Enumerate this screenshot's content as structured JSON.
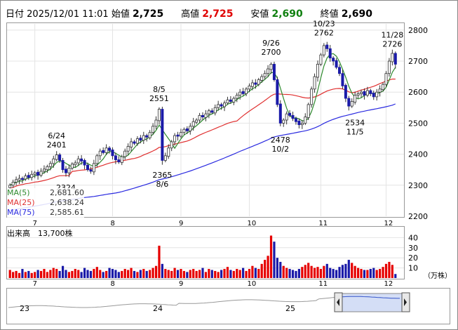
{
  "header": {
    "date_label": "日付",
    "datetime": "2025/12/01 11:01",
    "open_label": "始値",
    "open": "2,725",
    "high_label": "高値",
    "high": "2,725",
    "low_label": "安値",
    "low": "2,690",
    "close_label": "終値",
    "close": "2,690"
  },
  "colors": {
    "up": "#e60000",
    "down": "#1a1aa8",
    "ma5": "#2e8b2e",
    "ma25": "#e03030",
    "ma75": "#2a2ae0",
    "high": "#e00000",
    "low": "#108010"
  },
  "ma_legend": [
    {
      "label": "MA(5)",
      "value": "2,681.60"
    },
    {
      "label": "MA(25)",
      "value": "2,638.24"
    },
    {
      "label": "MA(75)",
      "value": "2,585.61"
    }
  ],
  "volume_label": "出来高　13,700株",
  "volume_unit": "（万株）",
  "chart_data": {
    "type": "candlestick",
    "price_axis": {
      "ylim": [
        2200,
        2820
      ],
      "ticks": [
        2200,
        2300,
        2400,
        2500,
        2600,
        2700,
        2800
      ]
    },
    "x_axis": {
      "month_ticks": [
        "7",
        "8",
        "9",
        "10",
        "11",
        "12"
      ]
    },
    "annotations": [
      {
        "date": "6/24",
        "value": 2401,
        "position": "above"
      },
      {
        "date": "",
        "value": 2324,
        "position": "below"
      },
      {
        "date": "8/5",
        "value": 2551,
        "position": "above"
      },
      {
        "date": "8/6",
        "value": 2365,
        "position": "below"
      },
      {
        "date": "9/26",
        "value": 2700,
        "position": "above"
      },
      {
        "date": "10/2",
        "value": 2478,
        "position": "below"
      },
      {
        "date": "10/23",
        "value": 2762,
        "position": "above"
      },
      {
        "date": "11/5",
        "value": 2534,
        "position": "below"
      },
      {
        "date": "11/28",
        "value": 2726,
        "position": "above"
      }
    ],
    "closes": [
      2300,
      2310,
      2318,
      2322,
      2320,
      2330,
      2325,
      2335,
      2340,
      2332,
      2345,
      2352,
      2360,
      2370,
      2385,
      2398,
      2380,
      2350,
      2340,
      2355,
      2368,
      2372,
      2385,
      2378,
      2365,
      2350,
      2345,
      2370,
      2395,
      2410,
      2405,
      2420,
      2412,
      2395,
      2382,
      2375,
      2392,
      2410,
      2425,
      2440,
      2435,
      2450,
      2445,
      2460,
      2455,
      2470,
      2490,
      2510,
      2545,
      2380,
      2395,
      2420,
      2440,
      2460,
      2458,
      2470,
      2480,
      2475,
      2490,
      2505,
      2510,
      2525,
      2520,
      2530,
      2540,
      2535,
      2550,
      2560,
      2555,
      2565,
      2575,
      2570,
      2580,
      2590,
      2600,
      2595,
      2610,
      2620,
      2630,
      2625,
      2640,
      2650,
      2660,
      2675,
      2690,
      2640,
      2560,
      2500,
      2510,
      2530,
      2525,
      2515,
      2505,
      2495,
      2500,
      2520,
      2560,
      2610,
      2650,
      2690,
      2720,
      2750,
      2740,
      2710,
      2700,
      2680,
      2660,
      2620,
      2580,
      2555,
      2570,
      2590,
      2595,
      2600,
      2590,
      2605,
      2595,
      2585,
      2600,
      2610,
      2625,
      2660,
      2700,
      2725,
      2690
    ],
    "ma_series": [
      {
        "name": "MA(5)",
        "last": 2681.6
      },
      {
        "name": "MA(25)",
        "last": 2638.24
      },
      {
        "name": "MA(75)",
        "last": 2585.61
      }
    ],
    "volume": {
      "ylim": [
        0,
        50
      ],
      "ticks": [
        10,
        20,
        30,
        40
      ],
      "values": [
        8,
        6,
        7,
        5,
        9,
        6,
        7,
        5,
        6,
        8,
        7,
        9,
        6,
        8,
        10,
        9,
        7,
        12,
        8,
        6,
        7,
        9,
        8,
        6,
        10,
        8,
        7,
        9,
        11,
        8,
        6,
        7,
        10,
        9,
        8,
        6,
        7,
        9,
        8,
        10,
        7,
        6,
        8,
        9,
        7,
        8,
        10,
        12,
        32,
        14,
        9,
        8,
        7,
        10,
        8,
        9,
        7,
        6,
        8,
        9,
        7,
        8,
        10,
        6,
        9,
        8,
        7,
        6,
        8,
        9,
        11,
        8,
        7,
        9,
        8,
        10,
        7,
        9,
        12,
        10,
        9,
        14,
        18,
        22,
        42,
        36,
        20,
        16,
        12,
        10,
        9,
        8,
        7,
        9,
        11,
        13,
        15,
        12,
        10,
        11,
        9,
        12,
        14,
        10,
        9,
        8,
        11,
        13,
        14,
        18,
        15,
        12,
        10,
        9,
        8,
        8,
        9,
        10,
        8,
        9,
        11,
        14,
        16,
        13,
        4
      ]
    },
    "overview_labels": [
      "23",
      "24",
      "25"
    ]
  }
}
